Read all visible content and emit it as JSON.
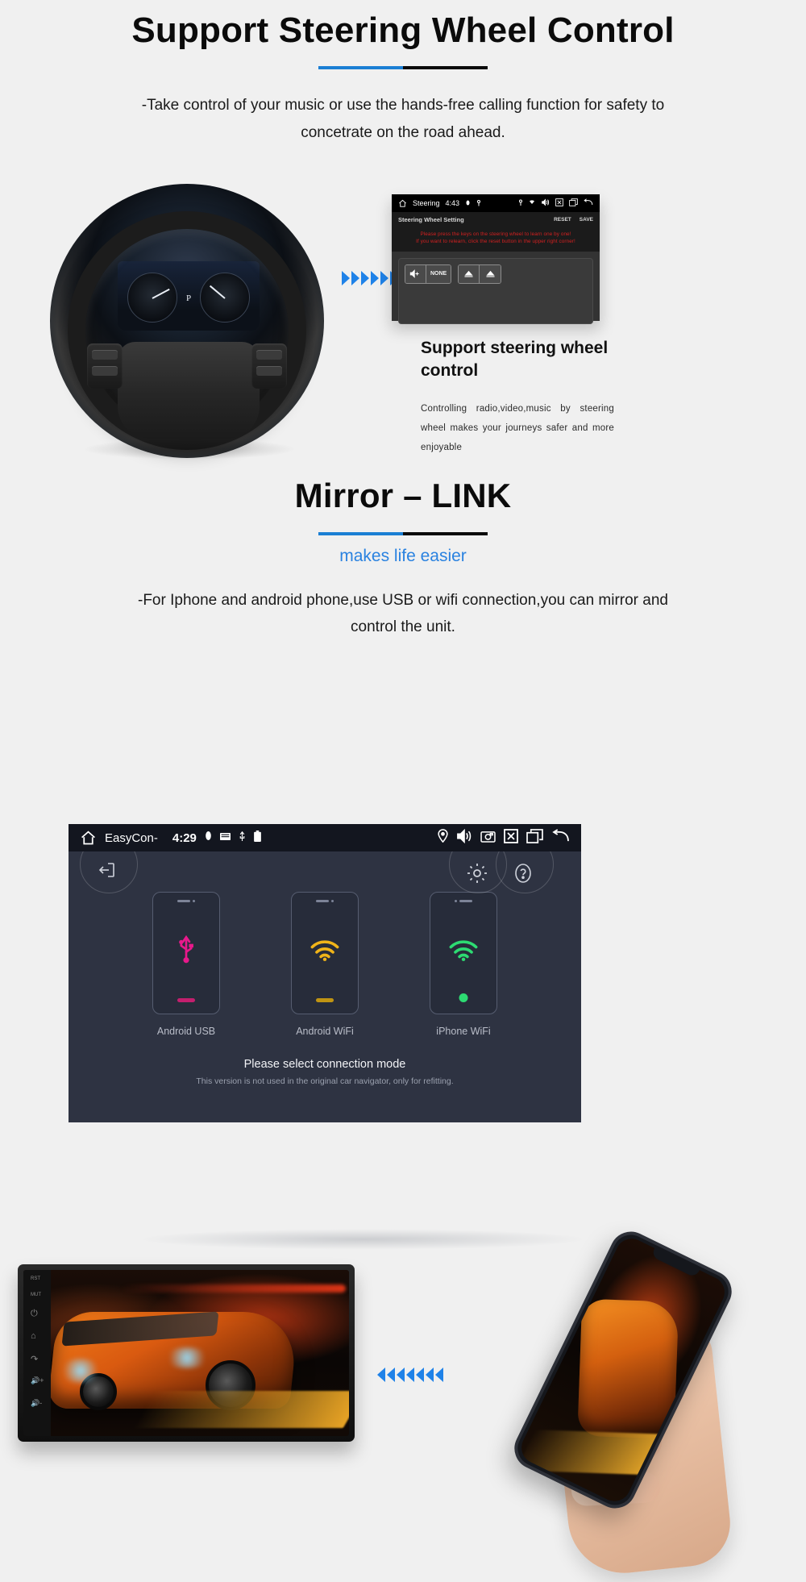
{
  "section1": {
    "title": "Support Steering Wheel Control",
    "lede": "-Take control of your music or use the hands-free calling function for safety to concetrate on the road ahead.",
    "steering_screen": {
      "status": {
        "app_label": "Steering",
        "time": "4:43",
        "home_icon": "home-icon",
        "bluetooth_icon": "bluetooth-icon",
        "gps_pin_icon": "location-pin-icon",
        "wifi_icon": "wifi-icon",
        "volume_icon": "volume-icon",
        "close_icon": "close-box-icon",
        "recents_icon": "recents-icon",
        "back_icon": "back-arrow-icon"
      },
      "page_title": "Steering Wheel Setting",
      "reset_label": "RESET",
      "save_label": "SAVE",
      "warning_line1": "Please press the keys on the steering wheel to learn one by one!",
      "warning_line2": "If you want to relearn, click the reset button in the upper right corner!",
      "keys": [
        {
          "icon": "volume-up-icon",
          "label": "NONE"
        },
        {
          "icon": "triangle-up-icon",
          "label": ""
        },
        {
          "icon": "triangle-up-icon",
          "label": ""
        }
      ],
      "warning_color": "#d32020"
    },
    "feature": {
      "heading": "Support steering wheel control",
      "body": "Controlling radio,video,music by steering wheel makes your journeys safer and more enjoyable"
    },
    "arrow_icon": "chevrons-right-icon",
    "wheel_photo_alt": "car-steering-wheel-with-instrument-cluster"
  },
  "section2": {
    "title": "Mirror – LINK",
    "subtitle": "makes life easier",
    "lede": "-For Iphone and android phone,use USB or wifi connection,you can mirror and control the unit.",
    "easyconnection": {
      "status": {
        "home_icon": "home-icon",
        "app_label": "EasyCon-",
        "time": "4:29",
        "bluetooth_icon": "bluetooth-icon",
        "sdcard_icon": "sd-card-icon",
        "usb_icon": "usb-icon",
        "battery_icon": "battery-icon",
        "location_icon": "location-pin-icon",
        "volume_icon": "volume-icon",
        "screenshot_icon": "camera-icon",
        "close_icon": "close-box-icon",
        "recents_icon": "recents-icon",
        "back_icon": "back-arrow-icon"
      },
      "floating": {
        "exit_icon": "exit-icon",
        "settings_icon": "gear-icon",
        "help_icon": "question-mark-icon"
      },
      "modes": [
        {
          "label": "Android USB",
          "glyph": "usb-icon",
          "color": "#e8198b",
          "home_shape": "bar"
        },
        {
          "label": "Android WiFi",
          "glyph": "wifi-icon",
          "color": "#f0b419",
          "home_shape": "bar"
        },
        {
          "label": "iPhone WiFi",
          "glyph": "wifi-icon",
          "color": "#2ddb72",
          "home_shape": "circle"
        }
      ],
      "footer_main": "Please select connection mode",
      "footer_note": "This version is not used in the original car navigator, only for refitting."
    },
    "montage": {
      "head_unit_alt": "car-head-unit-showing-racing-game",
      "phone_alt": "hand-holding-smartphone-showing-same-racing-game",
      "arrow_icon": "chevrons-left-icon",
      "unit_buttons": [
        "rst-label",
        "mute-label",
        "power-icon",
        "home-icon",
        "back-icon",
        "volume-up-icon",
        "volume-down-icon"
      ]
    }
  },
  "theme": {
    "background": "#f0f0f0",
    "accent_blue": "#1b7fd4",
    "link_blue": "#2a82e0",
    "dark_panel": "#2e3342",
    "black_bar": "#13161f"
  }
}
